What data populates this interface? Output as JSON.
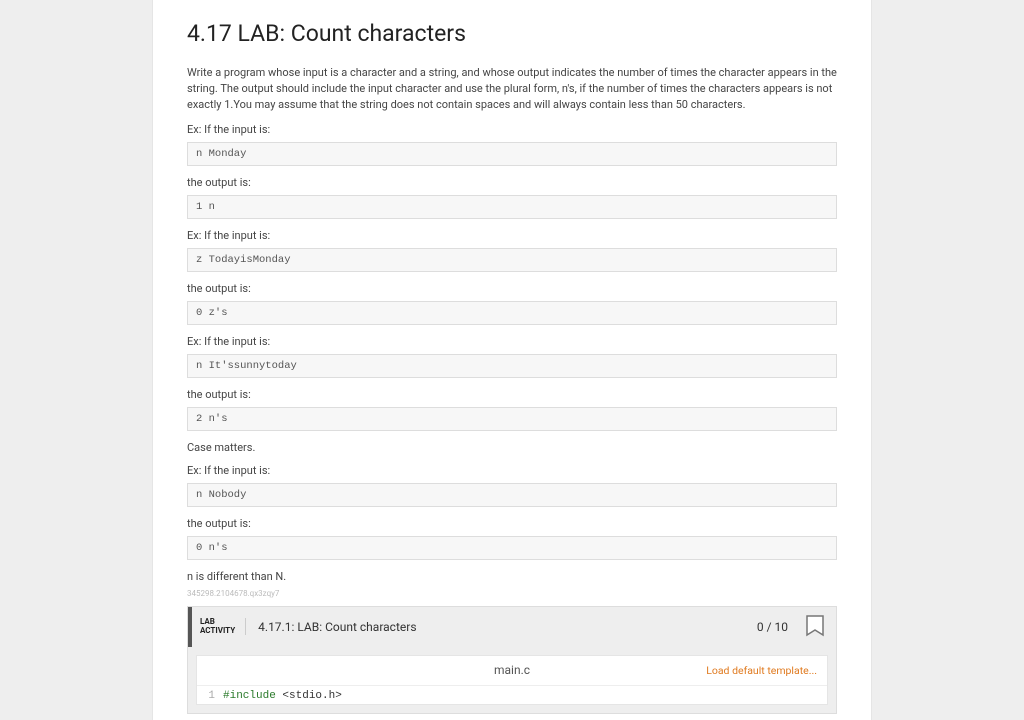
{
  "title": "4.17 LAB: Count characters",
  "description": "Write a program whose input is a character and a string, and whose output indicates the number of times the character appears in the string. The output should include the input character and use the plural form, n's, if the number of times the characters appears is not exactly 1.You may assume that the string does not contain spaces and will always contain less than 50 characters.",
  "ex1_label": "Ex: If the input is:",
  "ex1_code": "n Monday",
  "out_label": "the output is:",
  "ex1_out": "1 n",
  "ex2_label": "Ex: If the input is:",
  "ex2_code": "z TodayisMonday",
  "ex2_out": "0 z's",
  "ex3_label": "Ex: If the input is:",
  "ex3_code": "n It'ssunnytoday",
  "ex3_out": "2 n's",
  "case_label": "Case matters.",
  "ex4_label": "Ex: If the input is:",
  "ex4_code": "n Nobody",
  "ex4_out": "0 n's",
  "diff_note": "n is different than N.",
  "tinyid": "345298.2104678.qx3zqy7",
  "activity": {
    "tag_line1": "LAB",
    "tag_line2": "ACTIVITY",
    "title": "4.17.1: LAB: Count characters",
    "score": "0 / 10"
  },
  "editor": {
    "filename": "main.c",
    "load_template": "Load default template...",
    "line1_num": "1",
    "line1_a": "#include",
    "line1_b": " <stdio.h>"
  }
}
